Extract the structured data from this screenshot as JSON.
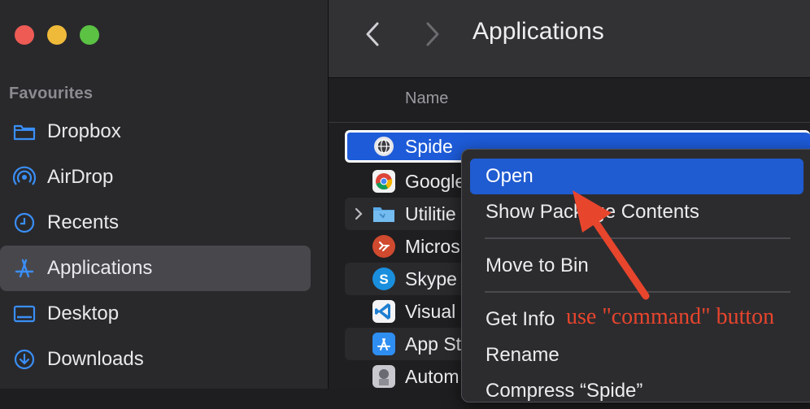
{
  "sidebar": {
    "section": "Favourites",
    "items": [
      {
        "label": "Dropbox",
        "icon": "folder-icon"
      },
      {
        "label": "AirDrop",
        "icon": "airdrop-icon"
      },
      {
        "label": "Recents",
        "icon": "clock-icon"
      },
      {
        "label": "Applications",
        "icon": "applications-icon",
        "selected": true
      },
      {
        "label": "Desktop",
        "icon": "desktop-icon"
      },
      {
        "label": "Downloads",
        "icon": "downloads-icon"
      }
    ]
  },
  "toolbar": {
    "title": "Applications"
  },
  "columns": {
    "name": "Name"
  },
  "files": [
    {
      "name": "Spide",
      "icon": "globe-app-icon",
      "selected": true
    },
    {
      "name": "Google",
      "icon": "chrome-icon"
    },
    {
      "name": "Utilitie",
      "icon": "utilities-folder-icon",
      "expandable": true
    },
    {
      "name": "Micros",
      "icon": "remote-desktop-icon"
    },
    {
      "name": "Skype",
      "icon": "skype-icon"
    },
    {
      "name": "Visual",
      "icon": "vscode-icon"
    },
    {
      "name": "App St",
      "icon": "app-store-icon"
    },
    {
      "name": "Autom",
      "icon": "automator-icon"
    }
  ],
  "context_menu": {
    "items": [
      {
        "label": "Open",
        "highlighted": true
      },
      {
        "label": "Show Package Contents"
      },
      {
        "label": "Move to Bin"
      },
      {
        "label": "Get Info"
      },
      {
        "label": "Rename"
      },
      {
        "label": "Compress “Spide”"
      }
    ]
  },
  "annotation": {
    "text": "use \"command\" button",
    "color": "#e8452d"
  },
  "colors": {
    "accent": "#1f5bd1",
    "sidebar_icon": "#3a8ef6"
  }
}
